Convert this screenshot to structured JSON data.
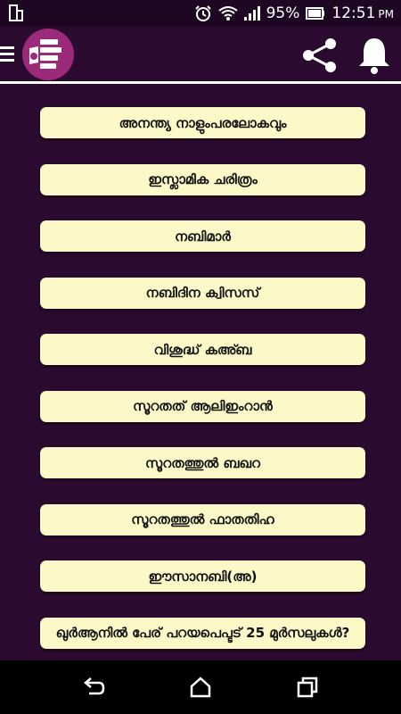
{
  "status_bar": {
    "battery_percent": "95%",
    "time": "12:51",
    "ampm": "PM",
    "icons": [
      "screen-rotate-icon",
      "alarm-icon",
      "wifi-icon",
      "signal-icon",
      "battery-icon"
    ]
  },
  "app_bar": {
    "icons": [
      "menu-icon",
      "quiz-logo",
      "share-icon",
      "bell-icon"
    ]
  },
  "topics": [
    "അനന്ത്യ നാളുംപരലോകവും",
    "ഇസ്ലാമിക ചരിത്രം",
    "നബിമാർ",
    "നബിദിന ക്വിസസ്",
    "വിശുദ്ധ് കഅ്ബ",
    "സൂറതത് ആലിഇംറാൻ",
    "സൂറതത്തുൽ ബഖറ",
    "സൂറതത്തുൽ ഫാതതിഹ",
    "ഈസാനബി(അ)",
    "ഖുർആനിൽ പേര് പറയപെപ്ടട് 25 മുർസലുകൾ?"
  ],
  "colors": {
    "background": "#2a0a2e",
    "button": "#fdf8c8",
    "logo": "#9b2a7a"
  },
  "nav_bar": {
    "icons": [
      "back-icon",
      "home-icon",
      "recents-icon"
    ]
  }
}
